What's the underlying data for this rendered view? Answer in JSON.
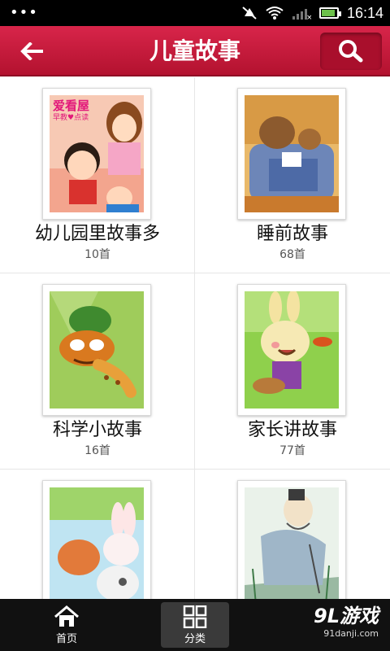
{
  "status_bar": {
    "time": "16:14",
    "dots": "•••"
  },
  "header": {
    "title": "儿童故事",
    "back_icon": "back-arrow-icon",
    "search_icon": "search-icon"
  },
  "categories": [
    {
      "title": "幼儿园里故事多",
      "count": "10首",
      "thumb_text_1": "爱看屋",
      "thumb_text_2": "早教♥点读"
    },
    {
      "title": "睡前故事",
      "count": "68首"
    },
    {
      "title": "科学小故事",
      "count": "16首"
    },
    {
      "title": "家长讲故事",
      "count": "77首"
    },
    {
      "title": "",
      "count": ""
    },
    {
      "title": "",
      "count": ""
    }
  ],
  "bottom_nav": {
    "tabs": [
      {
        "label": "首页",
        "icon": "home-icon"
      },
      {
        "label": "分类",
        "icon": "grid-icon"
      }
    ],
    "active": "分类"
  },
  "watermark": {
    "main": "9L游戏",
    "sub": "91danji.com"
  },
  "colors": {
    "header": "#c81a3c",
    "bottom_bar": "#111111"
  }
}
